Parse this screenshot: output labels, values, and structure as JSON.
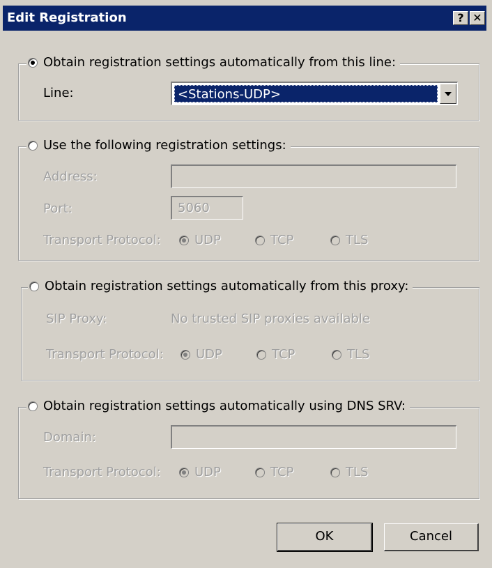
{
  "window": {
    "title": "Edit Registration",
    "help_label": "?",
    "close_label": "✕"
  },
  "group_line": {
    "legend": "Obtain registration settings automatically from this line:",
    "selected": true,
    "line_label": "Line:",
    "line_value": "<Stations-UDP>"
  },
  "group_manual": {
    "legend": "Use the following registration settings:",
    "selected": false,
    "address_label": "Address:",
    "address_value": "",
    "port_label": "Port:",
    "port_value": "5060",
    "transport_label": "Transport Protocol:",
    "protocols": [
      "UDP",
      "TCP",
      "TLS"
    ],
    "selected_protocol": "UDP"
  },
  "group_proxy": {
    "legend": "Obtain registration settings automatically from this proxy:",
    "selected": false,
    "proxy_label": "SIP Proxy:",
    "proxy_value": "No trusted SIP proxies available",
    "transport_label": "Transport Protocol:",
    "protocols": [
      "UDP",
      "TCP",
      "TLS"
    ],
    "selected_protocol": "UDP"
  },
  "group_dns": {
    "legend": "Obtain registration settings automatically using DNS SRV:",
    "selected": false,
    "domain_label": "Domain:",
    "domain_value": "",
    "transport_label": "Transport Protocol:",
    "protocols": [
      "UDP",
      "TCP",
      "TLS"
    ],
    "selected_protocol": "UDP"
  },
  "buttons": {
    "ok": "OK",
    "cancel": "Cancel"
  }
}
